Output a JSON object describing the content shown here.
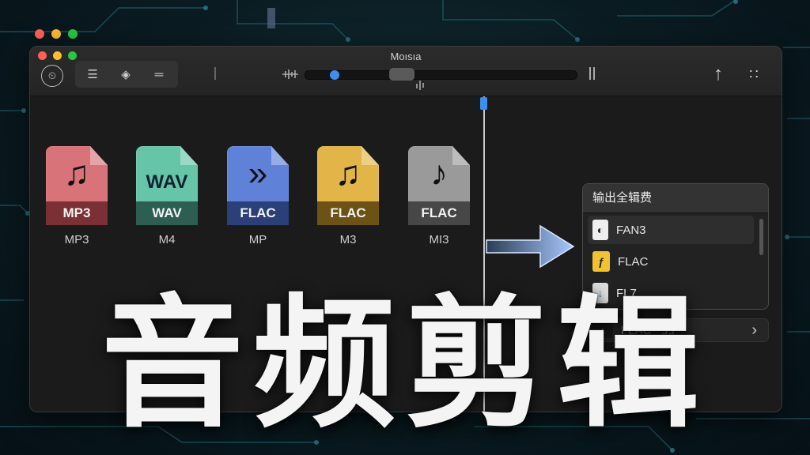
{
  "window": {
    "title": "Moısıa"
  },
  "toolbar": {
    "buttons": [
      {
        "name": "timer-icon",
        "glyph": "⏲"
      },
      {
        "name": "split-icon",
        "glyph": "☰"
      },
      {
        "name": "eye-icon",
        "glyph": "◈"
      },
      {
        "name": "trim-icon",
        "glyph": "═"
      }
    ],
    "progress": 0.09,
    "thumb": 0.31,
    "share_glyph": "↑",
    "more_glyph": "∷"
  },
  "files": [
    {
      "band": "MP3",
      "label": "MP3",
      "icon": "music-note-icon",
      "glyph": "♫",
      "color": "#d9737a",
      "band_color": "#7a3035"
    },
    {
      "band": "WAV",
      "label": "M4",
      "big": "WAV",
      "icon": "wav-icon",
      "color": "#66c4a7",
      "band_color": "#2c5f52"
    },
    {
      "band": "FLAC",
      "label": "MP",
      "icon": "play-arrows-icon",
      "glyph": "»",
      "color": "#5f82d8",
      "band_color": "#2b3f78"
    },
    {
      "band": "FLAC",
      "label": "M3",
      "icon": "music-note-icon",
      "glyph": "♫",
      "color": "#e1b547",
      "band_color": "#6c5214"
    },
    {
      "band": "FLAC",
      "label": "MI3",
      "icon": "audio-file-icon",
      "glyph": "♪",
      "color": "#9a9a9a",
      "band_color": "#474747"
    }
  ],
  "export_panel": {
    "title": "输出全辑费",
    "options": [
      {
        "label": "FAN3",
        "icon": "document-icon",
        "selected": true
      },
      {
        "label": "FLAC",
        "icon": "flac-format-icon",
        "selected": false
      },
      {
        "label": "FL7",
        "icon": "download-file-icon",
        "selected": false
      }
    ]
  },
  "combo": {
    "value": "FLAC",
    "extra": "ℲℲ",
    "chevron": "›"
  },
  "headline": "音频剪辑",
  "colors": {
    "close": "#ff5f57",
    "minimize": "#febc2e",
    "zoom": "#28c840",
    "accent": "#3b8ff0"
  }
}
